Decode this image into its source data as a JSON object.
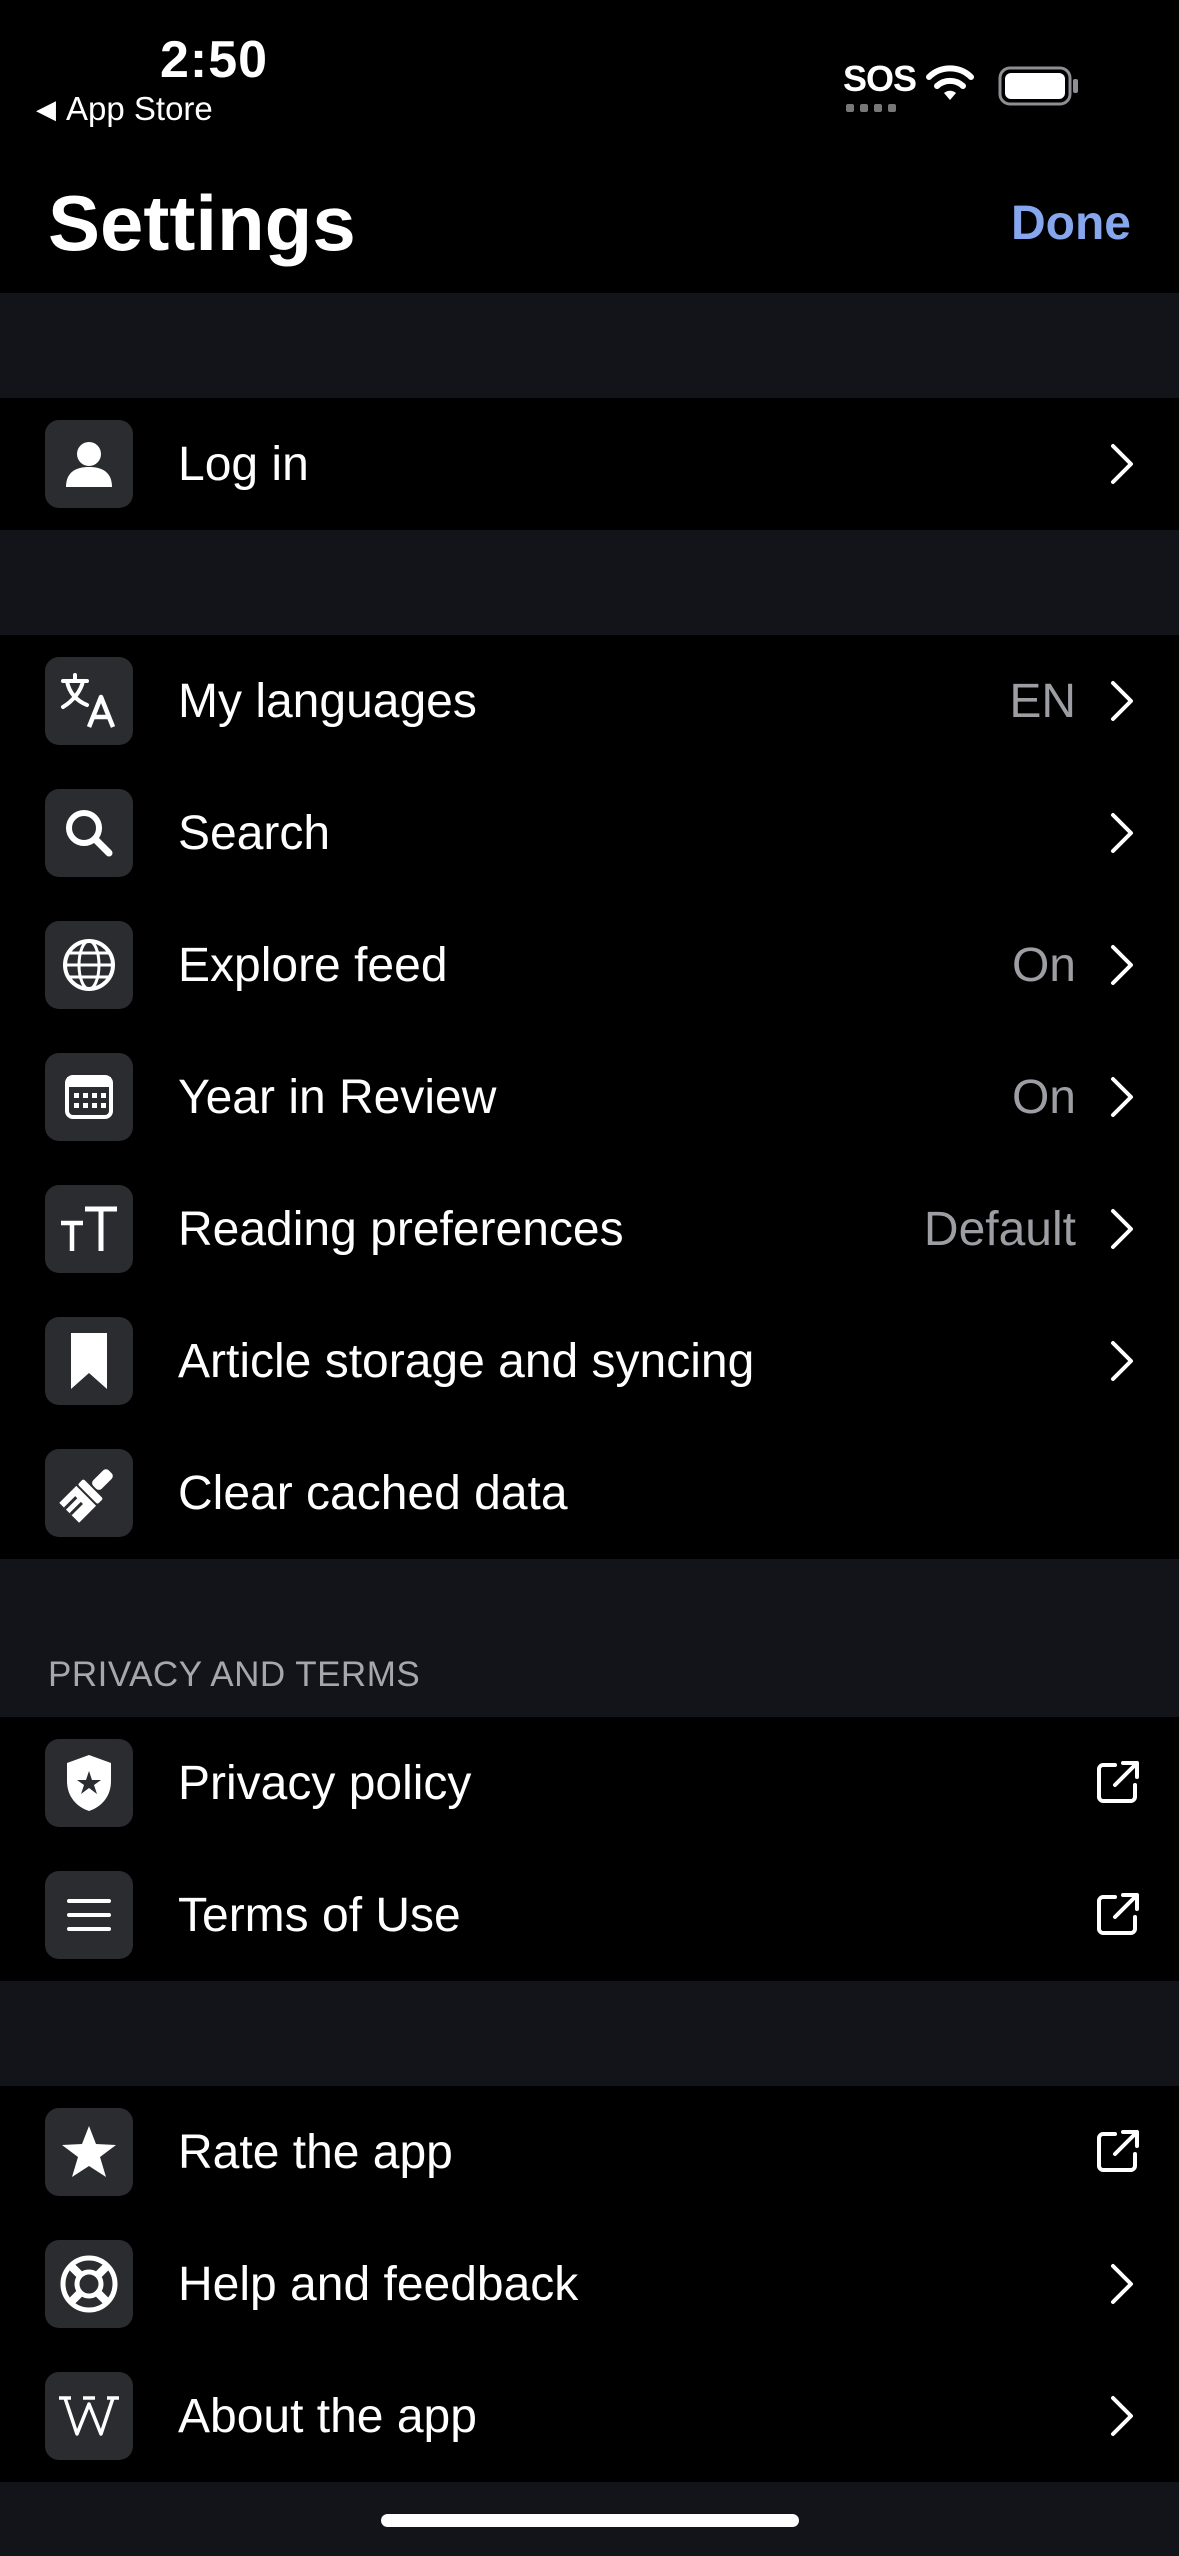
{
  "status_bar": {
    "time": "2:50",
    "back_app": "App Store",
    "carrier": "SOS"
  },
  "nav": {
    "title": "Settings",
    "done": "Done"
  },
  "account": {
    "login": "Log in"
  },
  "general": {
    "languages": {
      "label": "My languages",
      "value": "EN"
    },
    "search": {
      "label": "Search"
    },
    "explore": {
      "label": "Explore feed",
      "value": "On"
    },
    "year": {
      "label": "Year in Review",
      "value": "On"
    },
    "reading": {
      "label": "Reading preferences",
      "value": "Default"
    },
    "storage": {
      "label": "Article storage and syncing"
    },
    "cache": {
      "label": "Clear cached data"
    }
  },
  "privacy": {
    "header": "PRIVACY AND TERMS",
    "policy": "Privacy policy",
    "terms": "Terms of Use"
  },
  "about": {
    "rate": "Rate the app",
    "help": "Help and feedback",
    "about": "About the app"
  },
  "colors": {
    "accent": "#86a7ee",
    "background": "#000000",
    "grouped_gap": "#13141a",
    "icon_tile": "#2b2c2f",
    "secondary_text": "#9d9ea4"
  }
}
